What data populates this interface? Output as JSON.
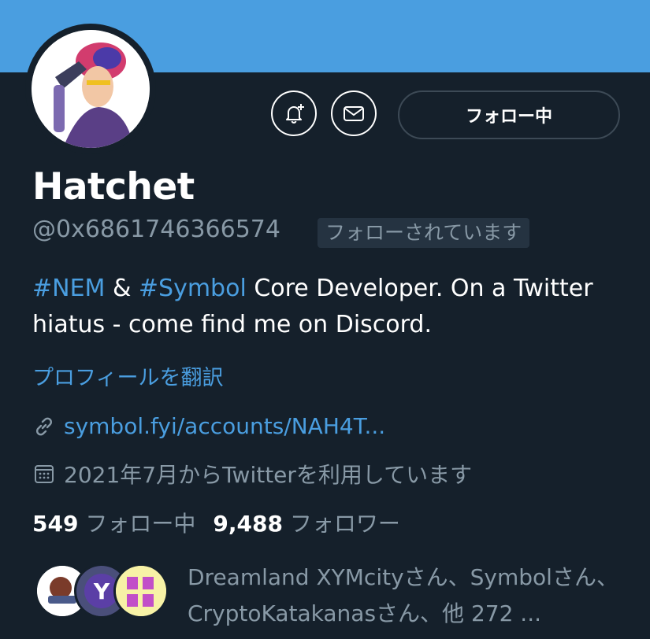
{
  "profile": {
    "name": "Hatchet",
    "handle": "@0x6861746366574",
    "follows_you_badge": "フォローされています",
    "bio_tag1": "#NEM",
    "bio_amp": " & ",
    "bio_tag2": "#Symbol",
    "bio_text": " Core Developer. On a Twitter hiatus - come find me on Discord.",
    "translate_label": "プロフィールを翻訳",
    "link_text": "symbol.fyi/accounts/NAH4T...",
    "joined_text": "2021年7月からTwitterを利用しています"
  },
  "actions": {
    "follow_label": "フォロー中",
    "notify_icon": "bell-plus-icon",
    "message_icon": "envelope-icon"
  },
  "stats": {
    "following_count": "549",
    "following_label": "フォロー中",
    "followers_count": "9,488",
    "followers_label": "フォロワー"
  },
  "known_followers": {
    "text": "Dreamland XYMcityさん、Symbolさん、CryptoKatakanasさん、他 272 ..."
  },
  "colors": {
    "banner": "#4a9ee0",
    "background": "#15202b",
    "accent": "#4a9ee0",
    "muted": "#8899a6"
  }
}
